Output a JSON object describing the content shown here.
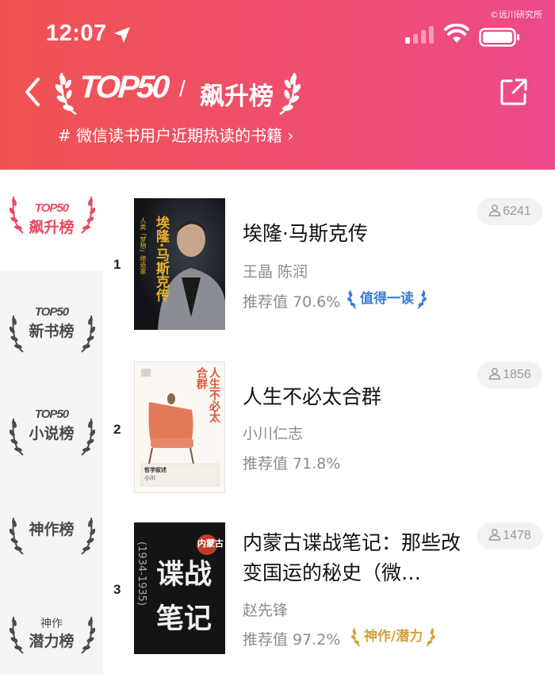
{
  "status_bar": {
    "time": "12:07",
    "watermark": "©远川研究所"
  },
  "header": {
    "logo_text": "TOP50",
    "slash": "/",
    "title": "飙升榜",
    "subtitle": "# 微信读书用户近期热读的书籍 ›"
  },
  "sidebar": {
    "items": [
      {
        "top": "TOP50",
        "label": "飙升榜",
        "active": true
      },
      {
        "top": "TOP50",
        "label": "新书榜",
        "active": false
      },
      {
        "top": "TOP50",
        "label": "小说榜",
        "active": false
      },
      {
        "top": "",
        "label": "神作榜",
        "active": false
      },
      {
        "top": "神作",
        "label": "潜力榜",
        "active": false
      }
    ]
  },
  "books": [
    {
      "rank": "1",
      "title": "埃隆·马斯克传",
      "author": "王晶 陈润",
      "score": "推荐值 70.6%",
      "badge": "值得一读",
      "readers": "6241",
      "cover_title": "埃隆·马斯克传",
      "cover_sub": "人类「梦想」缔造家"
    },
    {
      "rank": "2",
      "title": "人生不必太合群",
      "author": "小川仁志",
      "score": "推荐值 71.8%",
      "badge": "",
      "readers": "1856",
      "cover_title": "人生不必太合群",
      "cover_series": "哲学叙述",
      "cover_author": "小川"
    },
    {
      "rank": "3",
      "title": "内蒙古谍战笔记：那些改变国运的秘史（微…",
      "author": "赵先锋",
      "score": "推荐值 97.2%",
      "badge": "神作/潜力",
      "readers": "1478",
      "cover_red": "内蒙古",
      "cover_title": "谍战笔记",
      "cover_years": "(1934-1935)"
    }
  ],
  "colors": {
    "header_gradient": [
      "#ef5350",
      "#ec4a8a"
    ],
    "accent_red": "#e94a62",
    "badge_blue": "#3b7bd6",
    "badge_gold": "#d4a13a"
  }
}
